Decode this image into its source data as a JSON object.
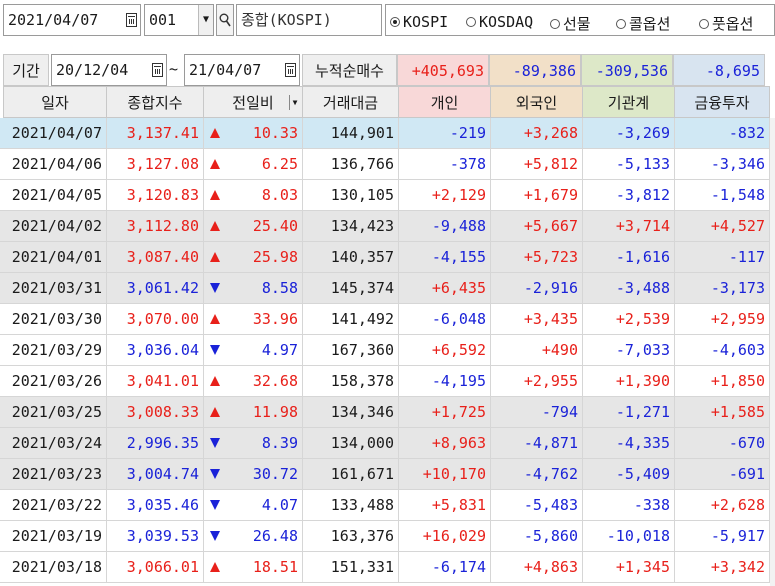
{
  "toolbar": {
    "date": "2021/04/07",
    "code": "001",
    "index_name": "종합(KOSPI)",
    "markets": [
      {
        "label": "KOSPI",
        "selected": true
      },
      {
        "label": "KOSDAQ",
        "selected": false
      },
      {
        "label": "선물",
        "selected": false
      },
      {
        "label": "콜옵션",
        "selected": false
      },
      {
        "label": "풋옵션",
        "selected": false
      }
    ]
  },
  "period": {
    "label": "기간",
    "from": "20/12/04",
    "sep": "~",
    "to": "21/04/07",
    "cumulative_label": "누적순매수",
    "totals": [
      "+405,693",
      "-89,386",
      "-309,536",
      "-8,695"
    ]
  },
  "columns": [
    "일자",
    "종합지수",
    "전일비",
    "거래대금",
    "개인",
    "외국인",
    "기관계",
    "금융투자"
  ],
  "rows": [
    {
      "date": "2021/04/07",
      "index": "3,137.41",
      "dir": "up",
      "chg": "10.33",
      "amount": "144,901",
      "indiv": "-219",
      "foreign": "+3,268",
      "inst": "-3,269",
      "fin": "-832",
      "style": "sel"
    },
    {
      "date": "2021/04/06",
      "index": "3,127.08",
      "dir": "up",
      "chg": "6.25",
      "amount": "136,766",
      "indiv": "-378",
      "foreign": "+5,812",
      "inst": "-5,133",
      "fin": "-3,346",
      "style": "white"
    },
    {
      "date": "2021/04/05",
      "index": "3,120.83",
      "dir": "up",
      "chg": "8.03",
      "amount": "130,105",
      "indiv": "+2,129",
      "foreign": "+1,679",
      "inst": "-3,812",
      "fin": "-1,548",
      "style": "white"
    },
    {
      "date": "2021/04/02",
      "index": "3,112.80",
      "dir": "up",
      "chg": "25.40",
      "amount": "134,423",
      "indiv": "-9,488",
      "foreign": "+5,667",
      "inst": "+3,714",
      "fin": "+4,527",
      "style": "gray"
    },
    {
      "date": "2021/04/01",
      "index": "3,087.40",
      "dir": "up",
      "chg": "25.98",
      "amount": "140,357",
      "indiv": "-4,155",
      "foreign": "+5,723",
      "inst": "-1,616",
      "fin": "-117",
      "style": "gray"
    },
    {
      "date": "2021/03/31",
      "index": "3,061.42",
      "dir": "down",
      "chg": "8.58",
      "amount": "145,374",
      "indiv": "+6,435",
      "foreign": "-2,916",
      "inst": "-3,488",
      "fin": "-3,173",
      "style": "gray"
    },
    {
      "date": "2021/03/30",
      "index": "3,070.00",
      "dir": "up",
      "chg": "33.96",
      "amount": "141,492",
      "indiv": "-6,048",
      "foreign": "+3,435",
      "inst": "+2,539",
      "fin": "+2,959",
      "style": "white"
    },
    {
      "date": "2021/03/29",
      "index": "3,036.04",
      "dir": "down",
      "chg": "4.97",
      "amount": "167,360",
      "indiv": "+6,592",
      "foreign": "+490",
      "inst": "-7,033",
      "fin": "-4,603",
      "style": "white"
    },
    {
      "date": "2021/03/26",
      "index": "3,041.01",
      "dir": "up",
      "chg": "32.68",
      "amount": "158,378",
      "indiv": "-4,195",
      "foreign": "+2,955",
      "inst": "+1,390",
      "fin": "+1,850",
      "style": "white"
    },
    {
      "date": "2021/03/25",
      "index": "3,008.33",
      "dir": "up",
      "chg": "11.98",
      "amount": "134,346",
      "indiv": "+1,725",
      "foreign": "-794",
      "inst": "-1,271",
      "fin": "+1,585",
      "style": "gray"
    },
    {
      "date": "2021/03/24",
      "index": "2,996.35",
      "dir": "down",
      "chg": "8.39",
      "amount": "134,000",
      "indiv": "+8,963",
      "foreign": "-4,871",
      "inst": "-4,335",
      "fin": "-670",
      "style": "gray"
    },
    {
      "date": "2021/03/23",
      "index": "3,004.74",
      "dir": "down",
      "chg": "30.72",
      "amount": "161,671",
      "indiv": "+10,170",
      "foreign": "-4,762",
      "inst": "-5,409",
      "fin": "-691",
      "style": "gray"
    },
    {
      "date": "2021/03/22",
      "index": "3,035.46",
      "dir": "down",
      "chg": "4.07",
      "amount": "133,488",
      "indiv": "+5,831",
      "foreign": "-5,483",
      "inst": "-338",
      "fin": "+2,628",
      "style": "white"
    },
    {
      "date": "2021/03/19",
      "index": "3,039.53",
      "dir": "down",
      "chg": "26.48",
      "amount": "163,376",
      "indiv": "+16,029",
      "foreign": "-5,860",
      "inst": "-10,018",
      "fin": "-5,917",
      "style": "white"
    },
    {
      "date": "2021/03/18",
      "index": "3,066.01",
      "dir": "up",
      "chg": "18.51",
      "amount": "151,331",
      "indiv": "-6,174",
      "foreign": "+4,863",
      "inst": "+1,345",
      "fin": "+3,342",
      "style": "white"
    }
  ],
  "colors": {
    "up": "#e8201a",
    "down": "#1a22d8",
    "selected_row": "#d0e8f4",
    "alt_row": "#e6e6e6",
    "header_individual": "#f8d8d8",
    "header_foreign": "#f2e0c8",
    "header_institution": "#dde8c8",
    "header_fin": "#d8e4f0"
  }
}
